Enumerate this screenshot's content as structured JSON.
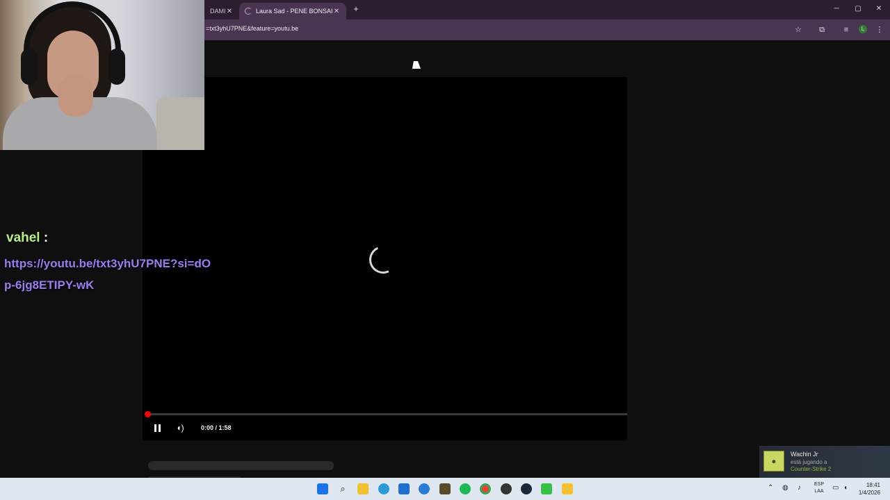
{
  "browser": {
    "tabs": [
      {
        "label": "DAMIL",
        "active": false
      },
      {
        "label": "Laura Sad - PENE BONSAI (Vid",
        "active": true
      }
    ],
    "close_glyph": "✕",
    "new_tab_glyph": "+",
    "url": "=txt3yhU7PNE&feature=youtu.be",
    "profile_initial": "L",
    "window_controls": {
      "minimize": "─",
      "maximize": "▢",
      "close": "✕"
    },
    "toolbar_icons": [
      "star-icon",
      "extensions-icon",
      "media-icon",
      "menu-icon"
    ]
  },
  "player": {
    "time_display": "0:00 / 1:58",
    "progress": 0,
    "state": "loading"
  },
  "chat": {
    "username": "vahel",
    "separator": ":",
    "message": "https://youtu.be/txt3yhU7PNE?si=dOp-6jg8ETIPY-wK"
  },
  "notification": {
    "name": "Wachin Jr",
    "status": "está jugando a",
    "game": "Counter-Strike 2"
  },
  "taskbar": {
    "apps": [
      "windows-start-icon",
      "search-icon",
      "file-explorer-icon",
      "edge-icon",
      "store-icon",
      "outlook-icon",
      "app-icon",
      "spotify-icon",
      "chrome-icon",
      "obs-icon",
      "steam-icon",
      "terminal-icon",
      "app2-icon"
    ],
    "language_line1": "ESP",
    "language_line2": "LAA",
    "time": "18:41",
    "date": "1/4/2026"
  },
  "colors": {
    "tab_bar": "#2b1f2f",
    "toolbar": "#4a3550",
    "progress": "#ff0000",
    "chat_user": "#b9f27f",
    "chat_message": "#9b7cf0"
  }
}
